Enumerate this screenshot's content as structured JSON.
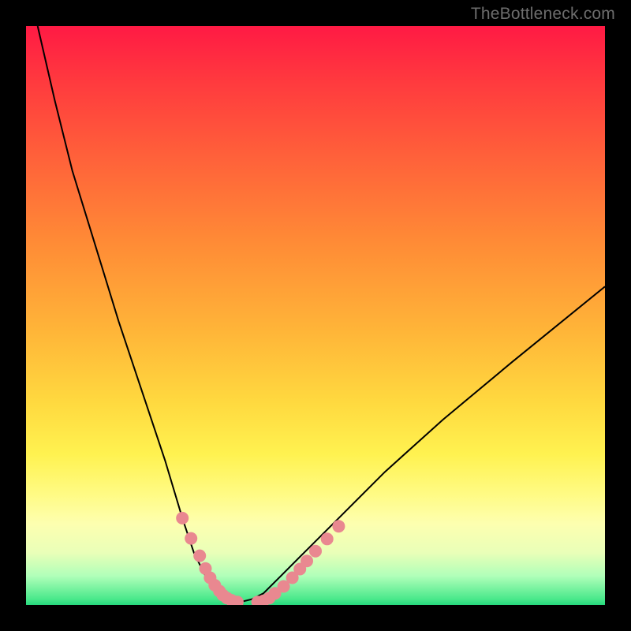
{
  "watermark": {
    "text": "TheBottleneck.com"
  },
  "chart_data": {
    "type": "line",
    "title": "",
    "xlabel": "",
    "ylabel": "",
    "xlim": [
      0,
      100
    ],
    "ylim": [
      0,
      100
    ],
    "series": [
      {
        "name": "bottleneck-curve",
        "x": [
          2,
          5,
          8,
          12,
          16,
          20,
          24,
          27,
          29,
          31,
          33,
          35,
          36,
          37,
          39,
          41,
          44,
          48,
          54,
          62,
          72,
          84,
          100
        ],
        "y": [
          100,
          87,
          75,
          62,
          49,
          37,
          25,
          15,
          9,
          5,
          2,
          1,
          0.5,
          0.5,
          1,
          2,
          5,
          9,
          15,
          23,
          32,
          42,
          55
        ]
      }
    ],
    "markers": {
      "name": "highlight-dots",
      "color": "#e98890",
      "x": [
        27,
        28.5,
        30,
        31,
        31.8,
        32.6,
        33.4,
        34,
        34.7,
        35.5,
        36.5,
        40,
        41,
        42,
        43,
        44.5,
        46,
        47.3,
        48.5,
        50,
        52,
        54
      ],
      "y": [
        15,
        11.5,
        8.5,
        6.3,
        4.7,
        3.4,
        2.4,
        1.7,
        1.2,
        0.8,
        0.5,
        0.5,
        0.7,
        1.2,
        2.0,
        3.2,
        4.7,
        6.2,
        7.6,
        9.3,
        11.4,
        13.6
      ]
    }
  }
}
